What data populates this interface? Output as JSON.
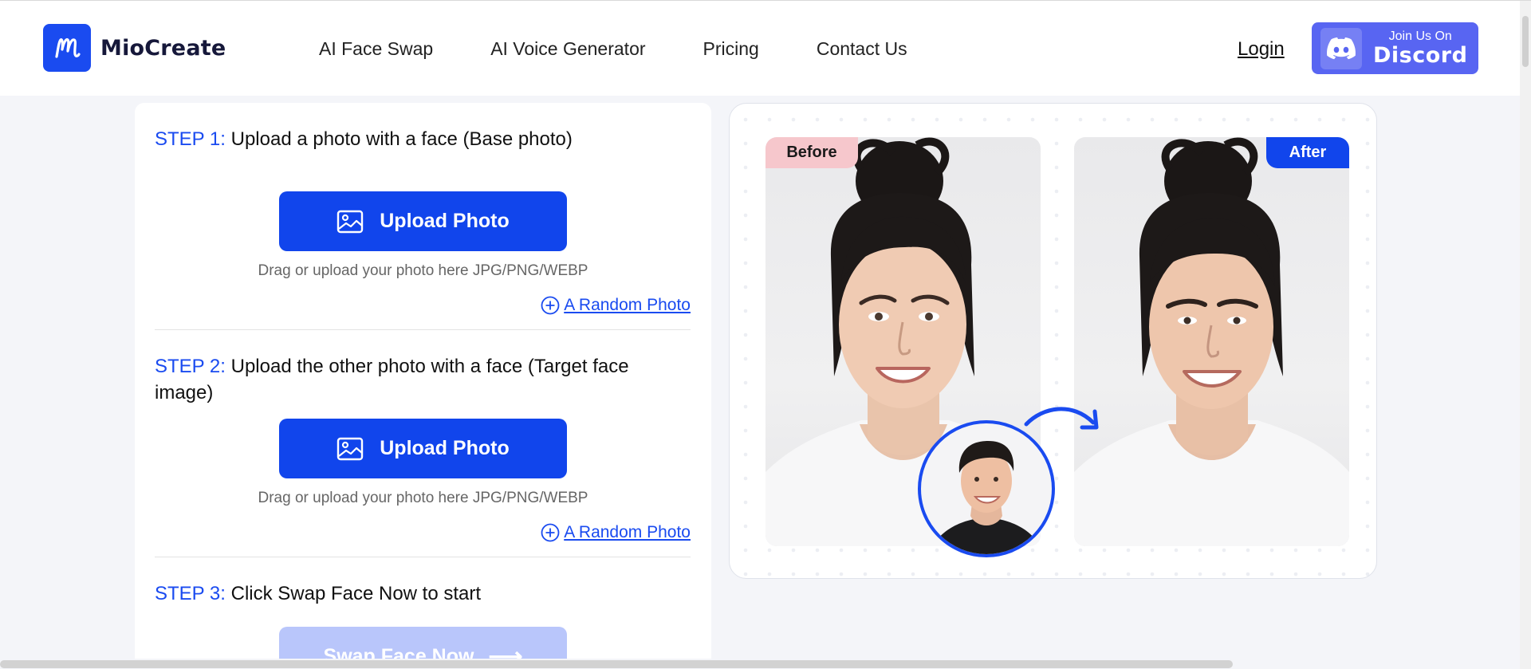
{
  "header": {
    "brand": "MioCreate",
    "nav": [
      {
        "label": "AI Face Swap"
      },
      {
        "label": "AI Voice Generator"
      },
      {
        "label": "Pricing"
      },
      {
        "label": "Contact Us"
      }
    ],
    "login_label": "Login",
    "discord": {
      "small": "Join Us On",
      "big": "Discord"
    }
  },
  "steps": {
    "step1": {
      "num": "STEP 1:",
      "text": " Upload a photo with a face (Base photo)"
    },
    "step2": {
      "num": "STEP 2:",
      "text": " Upload the other photo with a face (Target face image)"
    },
    "step3": {
      "num": "STEP 3:",
      "text": " Click Swap Face Now to start"
    }
  },
  "upload": {
    "button_label": "Upload Photo",
    "hint": "Drag or upload your photo here JPG/PNG/WEBP",
    "random_label": "A Random Photo"
  },
  "swap_button_label": "Swap Face Now",
  "preview": {
    "before_label": "Before",
    "after_label": "After"
  },
  "colors": {
    "accent": "#1145ec",
    "accent_disabled": "#b9c6fb",
    "discord": "#5865f2",
    "before_tag": "#f6c7cc"
  },
  "icons": [
    "miocreate-logo-icon",
    "discord-icon",
    "image-icon",
    "plus-circle-icon",
    "arrow-right-icon",
    "curved-arrow-icon"
  ]
}
